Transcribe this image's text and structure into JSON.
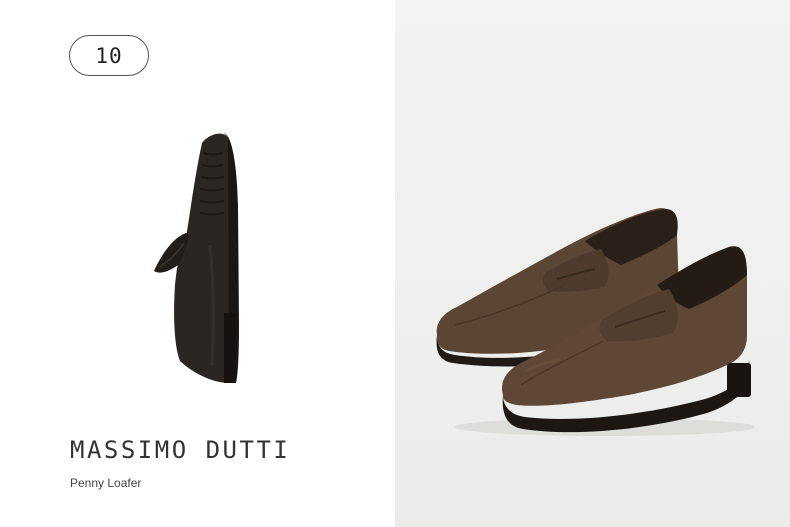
{
  "badge": {
    "number": "10"
  },
  "product": {
    "brand": "MASSIMO DUTTI",
    "name": "Penny Loafer"
  },
  "colors": {
    "side_shoe": "#2a2521",
    "suede": "#5a4433",
    "sole": "#1e1a17",
    "photo_background": "#efefee"
  },
  "images": {
    "left": "side-view-loafer",
    "right": "suede-loafer-pair"
  }
}
